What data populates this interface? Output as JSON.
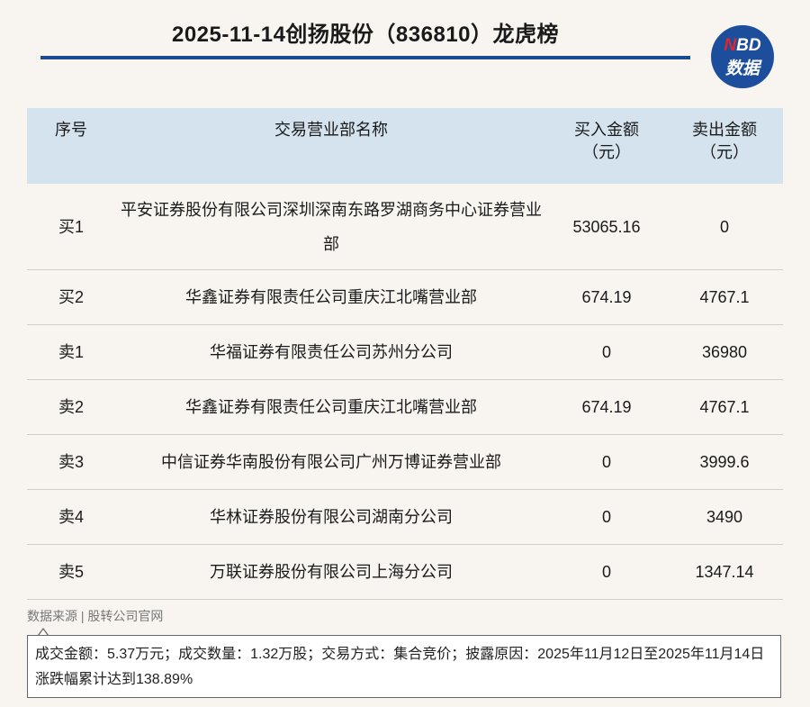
{
  "title": "2025-11-14创扬股份（836810）龙虎榜",
  "logo": {
    "line1_n": "N",
    "line1_rest": "BD",
    "line2": "数据"
  },
  "table": {
    "headers": {
      "no": "序号",
      "name": "交易营业部名称",
      "buy_line1": "买入金额",
      "buy_line2": "（元）",
      "sell_line1": "卖出金额",
      "sell_line2": "（元）"
    },
    "rows": [
      {
        "no": "买1",
        "name": "平安证券股份有限公司深圳深南东路罗湖商务中心证券营业部",
        "buy": "53065.16",
        "sell": "0"
      },
      {
        "no": "买2",
        "name": "华鑫证券有限责任公司重庆江北嘴营业部",
        "buy": "674.19",
        "sell": "4767.1"
      },
      {
        "no": "卖1",
        "name": "华福证券有限责任公司苏州分公司",
        "buy": "0",
        "sell": "36980"
      },
      {
        "no": "卖2",
        "name": "华鑫证券有限责任公司重庆江北嘴营业部",
        "buy": "674.19",
        "sell": "4767.1"
      },
      {
        "no": "卖3",
        "name": "中信证券华南股份有限公司广州万博证券营业部",
        "buy": "0",
        "sell": "3999.6"
      },
      {
        "no": "卖4",
        "name": "华林证券股份有限公司湖南分公司",
        "buy": "0",
        "sell": "3490"
      },
      {
        "no": "卖5",
        "name": "万联证券股份有限公司上海分公司",
        "buy": "0",
        "sell": "1347.14"
      }
    ]
  },
  "source": "数据来源 | 股转公司官网",
  "note": "成交金额：5.37万元；成交数量：1.32万股；交易方式：集合竞价；披露原因：2025年11月12日至2025年11月14日涨跌幅累计达到138.89%",
  "colors": {
    "accent": "#1a4a94",
    "header_bg": "#d5e3ef",
    "logo_bg": "#1d4e9c",
    "logo_red": "#e0252b"
  }
}
